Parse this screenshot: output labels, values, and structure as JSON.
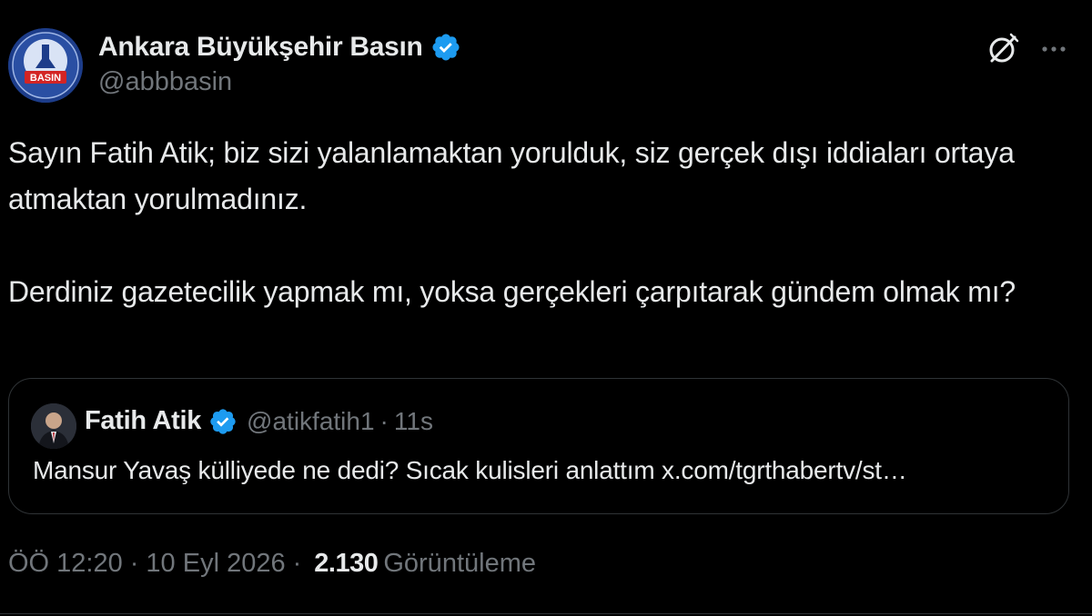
{
  "author": {
    "display_name": "Ankara Büyükşehir Basın",
    "handle": "@abbbasin",
    "avatar_label": "BASIN",
    "verified": true
  },
  "body": {
    "paragraphs": [
      "Sayın Fatih Atik; biz sizi yalanlamaktan yorulduk, siz gerçek dışı iddiaları ortaya atmaktan yorulmadınız.",
      "Derdiniz gazetecilik yapmak mı, yoksa gerçekleri çarpıtarak gündem olmak mı?"
    ]
  },
  "quote": {
    "display_name": "Fatih Atik",
    "handle": "@atikfatih1",
    "separator": "·",
    "time": "11s",
    "text": "Mansur Yavaş külliyede ne dedi? Sıcak kulisleri anlattım x.com/tgrthabertv/st…",
    "verified": true
  },
  "meta": {
    "time": "ÖÖ 12:20",
    "separator": "·",
    "date": "10 Eyl 2026",
    "views_count": "2.130",
    "views_label": "Görüntüleme"
  },
  "colors": {
    "background": "#000000",
    "text": "#e7e9ea",
    "muted": "#71767b",
    "verified": "#1d9bf0",
    "border": "#2f3336"
  },
  "icons": {
    "grok": "grok-icon",
    "more": "more-icon",
    "verified": "verified-badge-icon"
  }
}
